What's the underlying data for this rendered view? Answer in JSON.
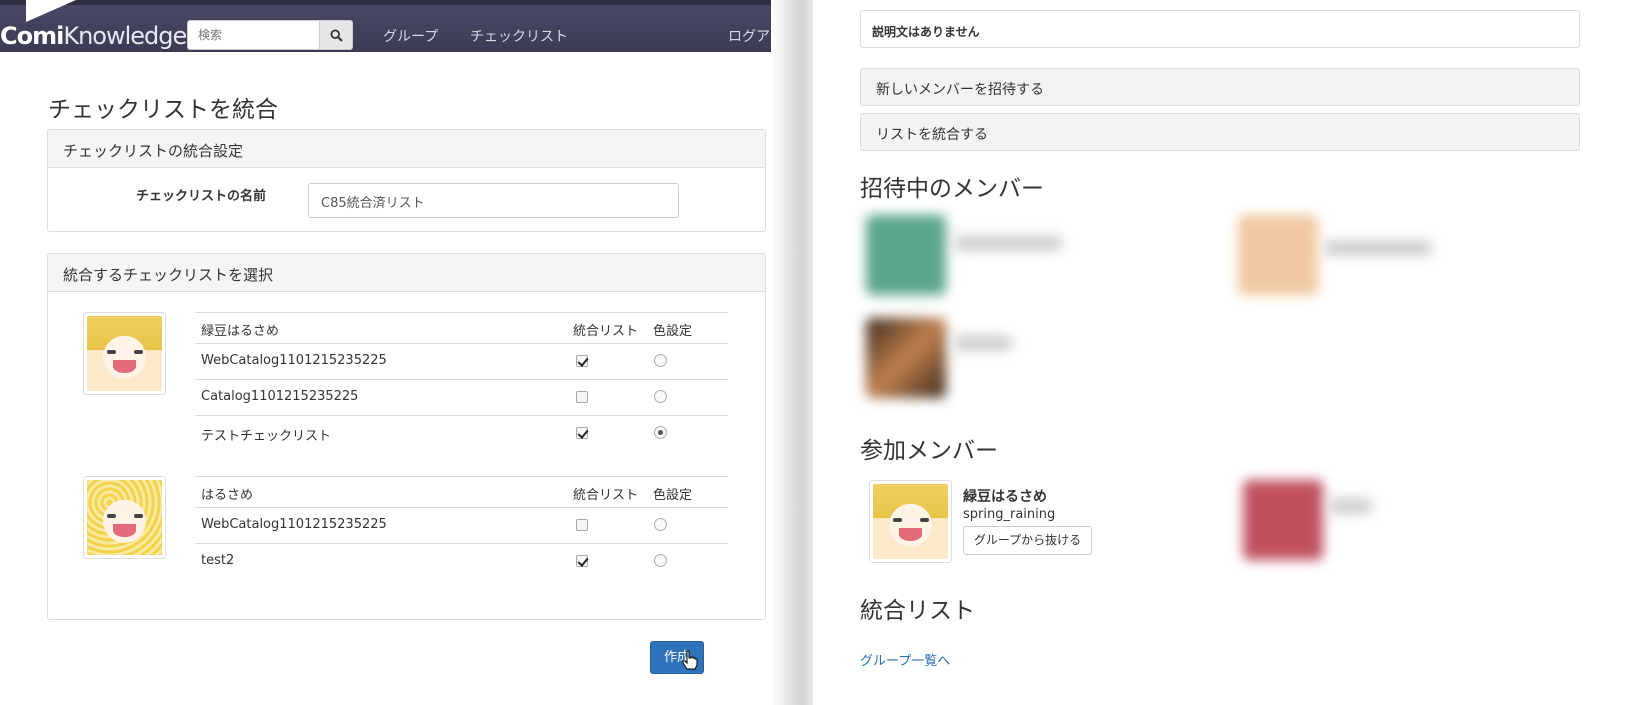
{
  "left_screen": {
    "navbar": {
      "logo_bold": "Comi",
      "logo_light": "Knowledge",
      "search_placeholder": "検索",
      "links": [
        "グループ",
        "チェックリスト",
        "ログアウト"
      ]
    },
    "page_title": "チェックリストを統合",
    "settings_panel": {
      "heading": "チェックリストの統合設定",
      "name_label": "チェックリストの名前",
      "name_value": "C85統合済リスト"
    },
    "select_panel": {
      "heading": "統合するチェックリストを選択",
      "users": [
        {
          "name": "緑豆はるさめ",
          "col_merge": "統合リスト",
          "col_color": "色設定",
          "lists": [
            {
              "title": "WebCatalog1101215235225",
              "merge": true,
              "color": false
            },
            {
              "title": "Catalog1101215235225",
              "merge": false,
              "color": false
            },
            {
              "title": "テストチェックリスト",
              "merge": true,
              "color": true
            }
          ]
        },
        {
          "name": "はるさめ",
          "col_merge": "統合リスト",
          "col_color": "色設定",
          "lists": [
            {
              "title": "WebCatalog1101215235225",
              "merge": false,
              "color": false
            },
            {
              "title": "test2",
              "merge": true,
              "color": false
            }
          ]
        }
      ]
    },
    "create_button": "作成"
  },
  "right_screen": {
    "description": "説明文はありません",
    "invite_button": "新しいメンバーを招待する",
    "merge_button": "リストを統合する",
    "invited_heading": "招待中のメンバー",
    "members_heading": "参加メンバー",
    "member": {
      "name": "緑豆はるさめ",
      "id": "spring_raining",
      "leave_button": "グループから抜ける"
    },
    "merged_heading": "統合リスト",
    "group_list_link": "グループ一覧へ"
  },
  "colors": {
    "navbar": "#3b3b55",
    "primary_button": "#2f73ba",
    "link": "#2a6db0"
  }
}
